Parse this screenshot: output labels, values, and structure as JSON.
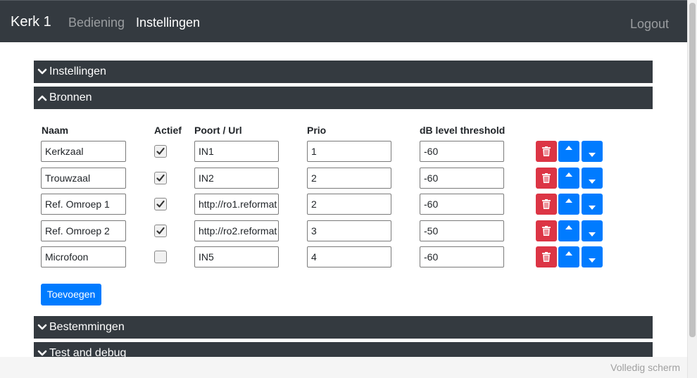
{
  "nav": {
    "brand": "Kerk 1",
    "links": [
      "Bediening",
      "Instellingen"
    ],
    "logout": "Logout"
  },
  "sections": {
    "instellingen": "Instellingen",
    "bronnen": "Bronnen",
    "bestemmingen": "Bestemmingen",
    "test": "Test and debug"
  },
  "table": {
    "headers": [
      "Naam",
      "Actief",
      "Poort / Url",
      "Prio",
      "dB level threshold"
    ],
    "rows": [
      {
        "naam": "Kerkzaal",
        "actief": true,
        "poort": "IN1",
        "prio": "1",
        "db": "-60"
      },
      {
        "naam": "Trouwzaal",
        "actief": true,
        "poort": "IN2",
        "prio": "2",
        "db": "-60"
      },
      {
        "naam": "Ref. Omroep 1",
        "actief": true,
        "poort": "http://ro1.reformat",
        "prio": "2",
        "db": "-60"
      },
      {
        "naam": "Ref. Omroep 2",
        "actief": true,
        "poort": "http://ro2.reformat",
        "prio": "3",
        "db": "-50"
      },
      {
        "naam": "Microfoon",
        "actief": false,
        "poort": "IN5",
        "prio": "4",
        "db": "-60"
      }
    ]
  },
  "add_button": "Toevoegen",
  "footer": {
    "fullscreen": "Volledig scherm"
  },
  "icons": {
    "delete": "trash-icon",
    "up": "caret-up-icon",
    "down": "caret-down-icon",
    "collapsed": "chevron-down-icon",
    "expanded": "chevron-up-icon"
  },
  "colors": {
    "navbar": "#343a40",
    "primary": "#007bff",
    "danger": "#dc3545"
  }
}
